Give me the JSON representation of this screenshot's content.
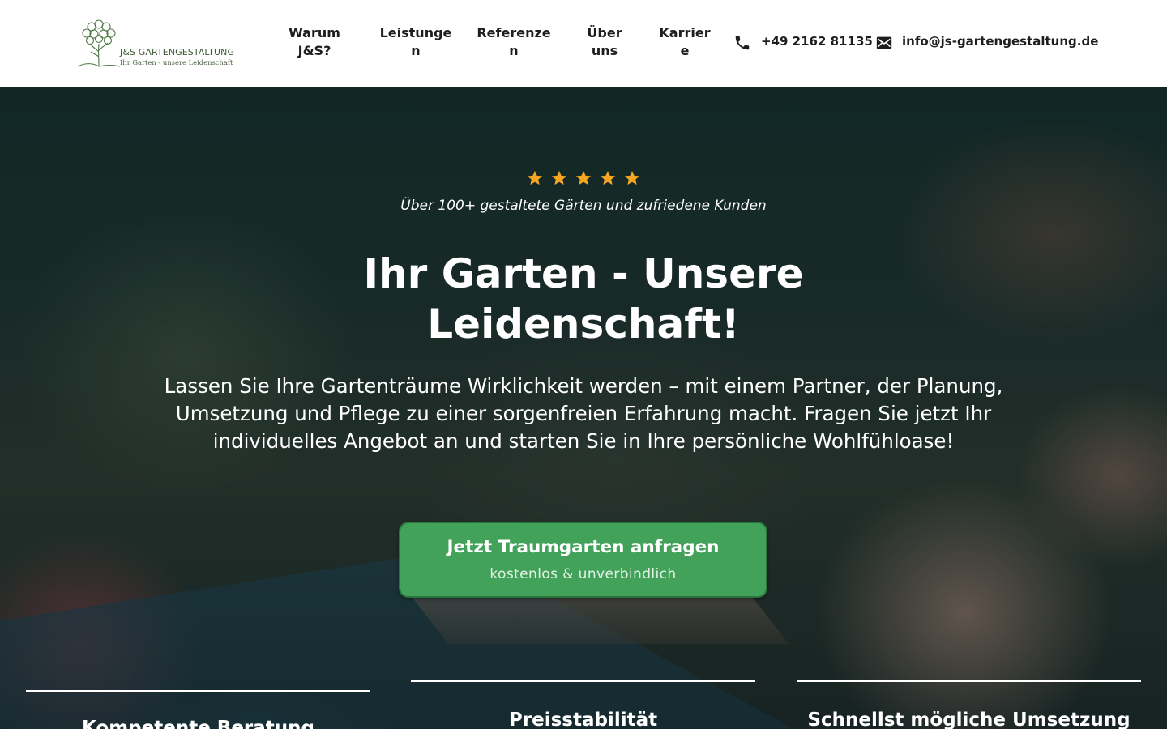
{
  "brand": {
    "name": "J&S GARTENGESTALTUNG",
    "tagline": "Ihr Garten - unsere Leidenschaft",
    "green": "#3d5a34"
  },
  "nav": {
    "items": [
      {
        "label": "Warum J&S?"
      },
      {
        "label": "Leistungen"
      },
      {
        "label": "Referenzen"
      },
      {
        "label": "Über uns"
      },
      {
        "label": "Karriere"
      }
    ]
  },
  "contact": {
    "phone": "+49 2162 81135",
    "phone_icon": "phone-icon",
    "email": "info@js-gartengestaltung.de",
    "email_icon": "mail-icon"
  },
  "hero": {
    "rating_stars": 5,
    "star_color": "#f5a623",
    "reviews_text": "Über 100+ gestaltete Gärten und zufriedene Kunden",
    "headline": "Ihr Garten - Unsere Leidenschaft!",
    "lead": "Lassen Sie Ihre Gartenträume Wirklichkeit werden – mit einem Partner, der Planung, Umsetzung und Pflege zu einer sorgenfreien Erfahrung macht. Fragen Sie jetzt Ihr individuelles Angebot an und starten Sie in Ihre persönliche Wohlfühloase!",
    "cta": {
      "label": "Jetzt Traumgarten anfragen",
      "sublabel": "kostenlos & unverbindlich",
      "color": "#43a25a"
    }
  },
  "features": [
    {
      "title": "Kompetente Beratung"
    },
    {
      "title": "Preisstabilität"
    },
    {
      "title": "Schnellst mögliche Umsetzung"
    }
  ]
}
